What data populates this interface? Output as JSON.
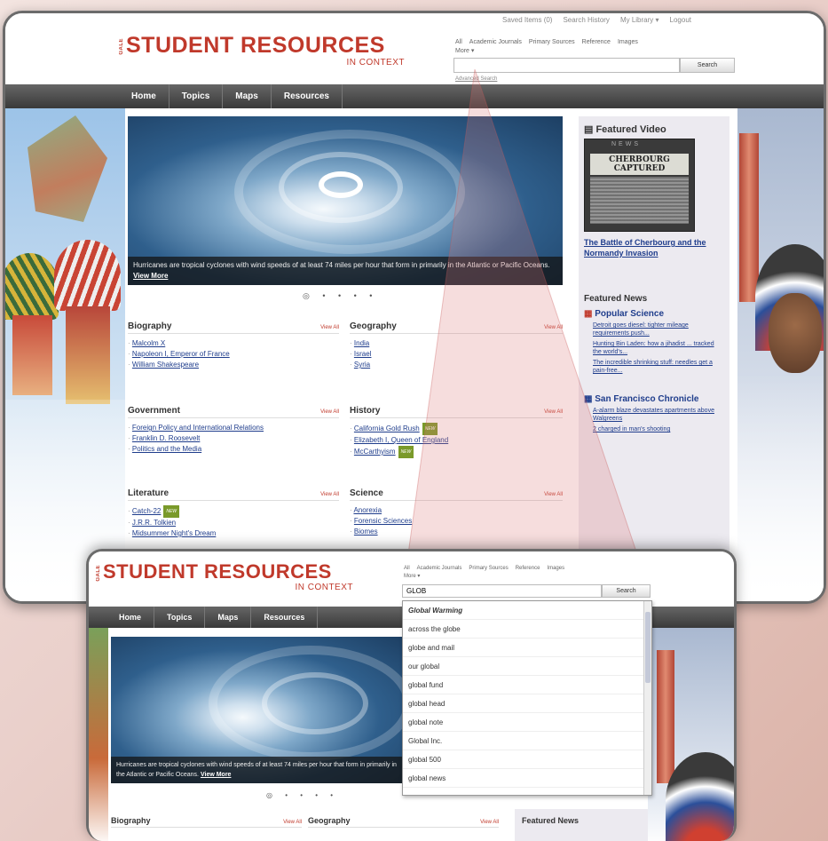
{
  "colors": {
    "brand": "#c0392b",
    "link": "#1f3d8c",
    "nav": "#3a3a3a",
    "new_badge": "#7a9a2a"
  },
  "header": {
    "logo_prefix": "GALE",
    "logo": "STUDENT RESOURCES",
    "logo_context": "IN CONTEXT",
    "top_links": [
      "Saved Items (0)",
      "Search History",
      "My Library ▾",
      "Logout"
    ],
    "search_tabs": [
      "All",
      "Academic Journals",
      "Primary Sources",
      "Reference",
      "Images",
      "More ▾"
    ],
    "search_value_main": "",
    "search_value_zoom": "GLOB",
    "search_button": "Search",
    "advanced_search": "Advanced Search"
  },
  "nav": {
    "items": [
      "Home",
      "Topics",
      "Maps",
      "Resources"
    ]
  },
  "hero": {
    "caption": "Hurricanes are tropical cyclones with wind speeds of at least 74 miles per hour that form in primarily in the Atlantic or Pacific Oceans.",
    "caption_zoom": "Hurricanes are tropical cyclones with wind speeds of at least 74 miles per hour that form in primarily in the Atlantic or Pacific Oceans.",
    "view_more": "View More",
    "dots": "◎ • • • •"
  },
  "sections": {
    "view_all": "View All",
    "biography": {
      "title": "Biography",
      "items": [
        "Malcolm X",
        "Napoleon I, Emperor of France",
        "William Shakespeare"
      ]
    },
    "geography": {
      "title": "Geography",
      "items": [
        "India",
        "Israel",
        "Syria"
      ]
    },
    "government": {
      "title": "Government",
      "items": [
        "Foreign Policy and International Relations",
        "Franklin D. Roosevelt",
        "Politics and the Media"
      ]
    },
    "history": {
      "title": "History",
      "items": [
        "California Gold Rush",
        "Elizabeth I, Queen of England",
        "McCarthyism"
      ]
    },
    "literature": {
      "title": "Literature",
      "items": [
        "Catch-22",
        "J.R.R. Tolkien",
        "Midsummer Night's Dream"
      ]
    },
    "science": {
      "title": "Science",
      "items": [
        "Anorexia",
        "Forensic Sciences",
        "Biomes"
      ]
    },
    "new_badge": "NEW"
  },
  "right": {
    "featured_video": "Featured Video",
    "video_thumb_title": "CHERBOURG CAPTURED",
    "video_thumb_label": "NEWS",
    "video_link": "The Battle of Cherbourg and the Normandy Invasion",
    "featured_news": "Featured News",
    "sources": [
      {
        "name": "Popular Science",
        "items": [
          "Detroit goes diesel: tighter mileage requirements push...",
          "Hunting Bin Laden: how a jihadist ... tracked the world's...",
          "The incredible shrinking stuff: needles get a pain-free..."
        ]
      },
      {
        "name": "San Francisco Chronicle",
        "items": [
          "A-alarm blaze devastates apartments above Walgreens",
          "2 charged in man's shooting"
        ]
      }
    ]
  },
  "dropdown": {
    "options": [
      "Global Warming",
      "across the globe",
      "globe and mail",
      "our global",
      "global fund",
      "global head",
      "global note",
      "Global Inc.",
      "global 500",
      "global news"
    ]
  }
}
